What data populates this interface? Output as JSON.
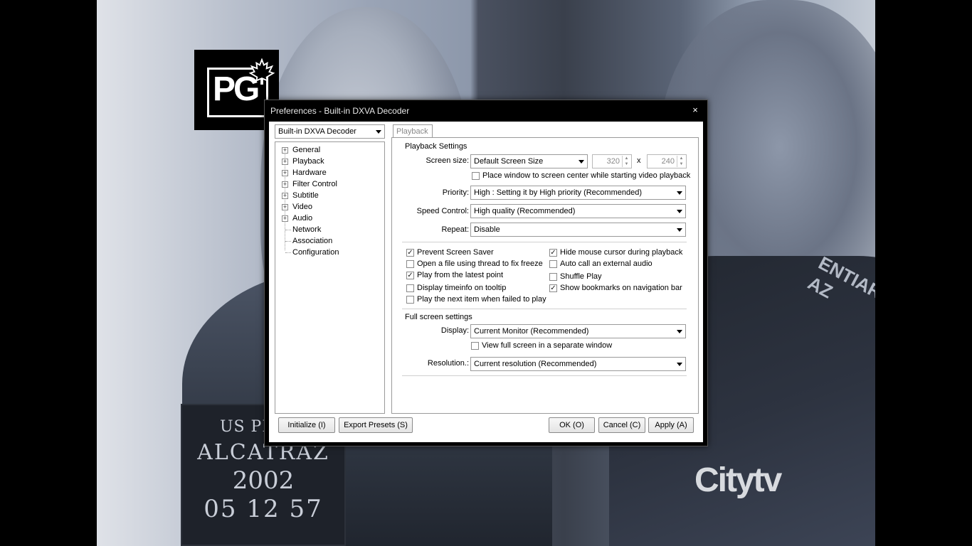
{
  "background": {
    "placard_lines": [
      "US PENIT",
      "ALCATRAZ",
      "2002",
      "05 12 57"
    ],
    "tag_lines": [
      "ENTIARY",
      "AZ"
    ],
    "pg_logo_text": "PG",
    "channel_logo": "Citytv"
  },
  "dialog": {
    "title": "Preferences - Built-in DXVA Decoder",
    "close_glyph": "×",
    "preset": "Built-in DXVA Decoder",
    "tree": [
      {
        "label": "General",
        "expandable": true
      },
      {
        "label": "Playback",
        "expandable": true
      },
      {
        "label": "Hardware",
        "expandable": true
      },
      {
        "label": "Filter Control",
        "expandable": true
      },
      {
        "label": "Subtitle",
        "expandable": true
      },
      {
        "label": "Video",
        "expandable": true
      },
      {
        "label": "Audio",
        "expandable": true
      },
      {
        "label": "Network",
        "expandable": false
      },
      {
        "label": "Association",
        "expandable": false
      },
      {
        "label": "Configuration",
        "expandable": false
      }
    ],
    "tab": "Playback",
    "playback_settings": {
      "title": "Playback Settings",
      "screen_size_label": "Screen size:",
      "screen_size_value": "Default Screen Size",
      "width": "320",
      "x_sep": "x",
      "height": "240",
      "center_window": "Place window to screen center while starting video playback",
      "priority_label": "Priority:",
      "priority_value": "High : Setting it by High priority (Recommended)",
      "speed_label": "Speed Control:",
      "speed_value": "High quality (Recommended)",
      "repeat_label": "Repeat:",
      "repeat_value": "Disable"
    },
    "options_left": [
      {
        "label": "Prevent Screen Saver",
        "checked": true
      },
      {
        "label": "Open a file using thread to fix freeze",
        "checked": false
      },
      {
        "label": "Play from the latest point",
        "checked": true
      },
      {
        "label": "Display timeinfo on tooltip",
        "checked": false
      },
      {
        "label": "Play the next item when failed to play",
        "checked": false
      }
    ],
    "options_right": [
      {
        "label": "Hide mouse cursor during playback",
        "checked": true
      },
      {
        "label": "Auto call an external audio",
        "checked": false
      },
      {
        "label": "Shuffle Play",
        "checked": false
      },
      {
        "label": "Show bookmarks on navigation bar",
        "checked": true
      }
    ],
    "fullscreen": {
      "title": "Full screen settings",
      "display_label": "Display:",
      "display_value": "Current Monitor (Recommended)",
      "separate_window": "View full screen in a separate window",
      "resolution_label": "Resolution.:",
      "resolution_value": "Current resolution (Recommended)"
    },
    "buttons": {
      "initialize": "Initialize (I)",
      "export": "Export Presets (S)",
      "ok": "OK (O)",
      "cancel": "Cancel (C)",
      "apply": "Apply (A)"
    },
    "check_glyph": "✓"
  }
}
